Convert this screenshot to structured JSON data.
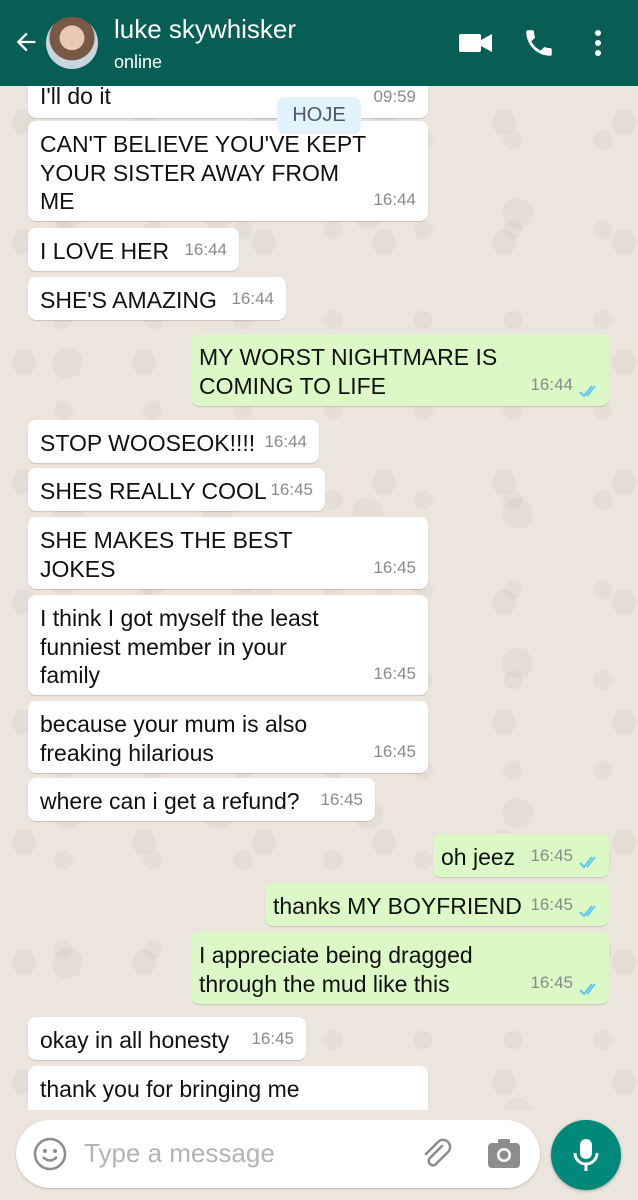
{
  "header": {
    "contact_name": "luke skywhisker",
    "status": "online",
    "colors": {
      "bar": "#075e54",
      "incoming": "#ffffff",
      "outgoing": "#dcf8c6",
      "read_ticks": "#4fc3f7"
    }
  },
  "date_chip": "HOJE",
  "messages": [
    {
      "text": "I'll do it",
      "time": "09:59",
      "dir": "in"
    },
    {
      "text": "CAN'T BELIEVE YOU'VE KEPT\nYOUR SISTER AWAY FROM\nME",
      "time": "16:44",
      "dir": "in"
    },
    {
      "text": "I LOVE HER",
      "time": "16:44",
      "dir": "in"
    },
    {
      "text": "SHE'S AMAZING",
      "time": "16:44",
      "dir": "in"
    },
    {
      "text": "MY WORST NIGHTMARE IS\nCOMING TO LIFE",
      "time": "16:44",
      "dir": "out",
      "status": "read"
    },
    {
      "text": "STOP WOOSEOK!!!!",
      "time": "16:44",
      "dir": "in"
    },
    {
      "text": "SHES REALLY COOL",
      "time": "16:45",
      "dir": "in"
    },
    {
      "text": "SHE MAKES THE BEST\nJOKES",
      "time": "16:45",
      "dir": "in"
    },
    {
      "text": "I think I got myself the least\nfunniest member in your\nfamily",
      "time": "16:45",
      "dir": "in"
    },
    {
      "text": "because your mum is also\nfreaking hilarious",
      "time": "16:45",
      "dir": "in"
    },
    {
      "text": "where can i get a refund?",
      "time": "16:45",
      "dir": "in"
    },
    {
      "text": "oh jeez",
      "time": "16:45",
      "dir": "out",
      "status": "read"
    },
    {
      "text": "thanks MY BOYFRIEND",
      "time": "16:45",
      "dir": "out",
      "status": "read"
    },
    {
      "text": "I appreciate being dragged\nthrough the mud like this",
      "time": "16:45",
      "dir": "out",
      "status": "read"
    },
    {
      "text": "okay in all honesty",
      "time": "16:45",
      "dir": "in"
    },
    {
      "text": "thank you for bringing me",
      "time": "",
      "dir": "in"
    }
  ],
  "composer": {
    "placeholder": "Type a message"
  },
  "icons": {
    "back": "arrow-left-icon",
    "video": "video-camera-icon",
    "call": "phone-icon",
    "menu": "more-vert-icon",
    "emoji": "emoji-icon",
    "attach": "paperclip-icon",
    "camera": "camera-icon",
    "mic": "microphone-icon"
  }
}
